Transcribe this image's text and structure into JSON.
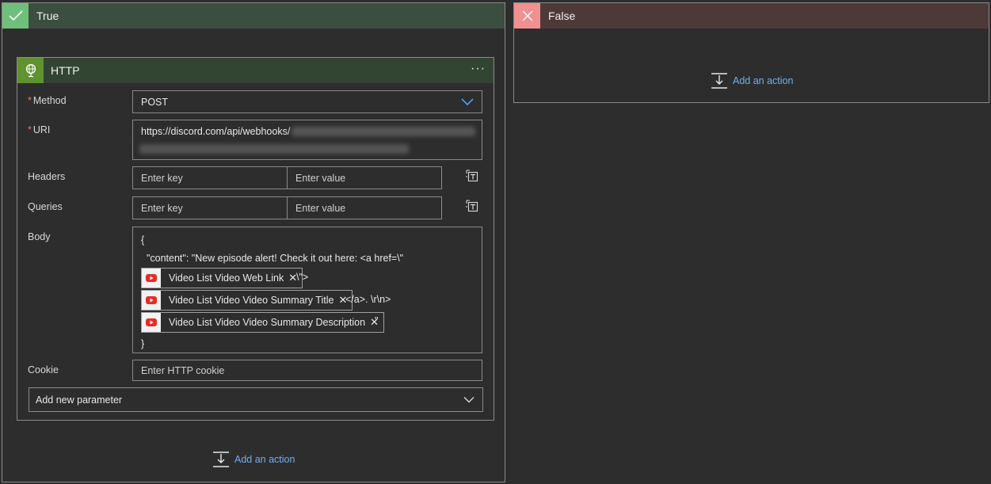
{
  "true_branch": {
    "title": "True",
    "add_action": "Add an action"
  },
  "false_branch": {
    "title": "False",
    "add_action": "Add an action"
  },
  "http_card": {
    "title": "HTTP",
    "menu": "···",
    "method": {
      "label": "Method",
      "value": "POST"
    },
    "uri": {
      "label": "URI",
      "value": "https://discord.com/api/webhooks/"
    },
    "headers": {
      "label": "Headers",
      "key_placeholder": "Enter key",
      "value_placeholder": "Enter value"
    },
    "queries": {
      "label": "Queries",
      "key_placeholder": "Enter key",
      "value_placeholder": "Enter value"
    },
    "body": {
      "label": "Body",
      "line1": "{",
      "line2": "  \"content\": \"New episode alert! Check it out here: <a href=\\\"",
      "token1": "Video List Video Web Link",
      "after1": "\\\">",
      "token2": "Video List Video Video Summary Title",
      "after2": "</a>. \\r\\n>",
      "token3": "Video List Video Video Summary Description",
      "after3": "\"",
      "line_end": "}"
    },
    "cookie": {
      "label": "Cookie",
      "placeholder": "Enter HTTP cookie"
    },
    "add_param": "Add new parameter"
  },
  "colors": {
    "accent_link": "#6fb0f0",
    "true_status": "#6ec07a",
    "false_status": "#f09090",
    "http_icon": "#60922e",
    "chevron": "#4aa3f0"
  }
}
